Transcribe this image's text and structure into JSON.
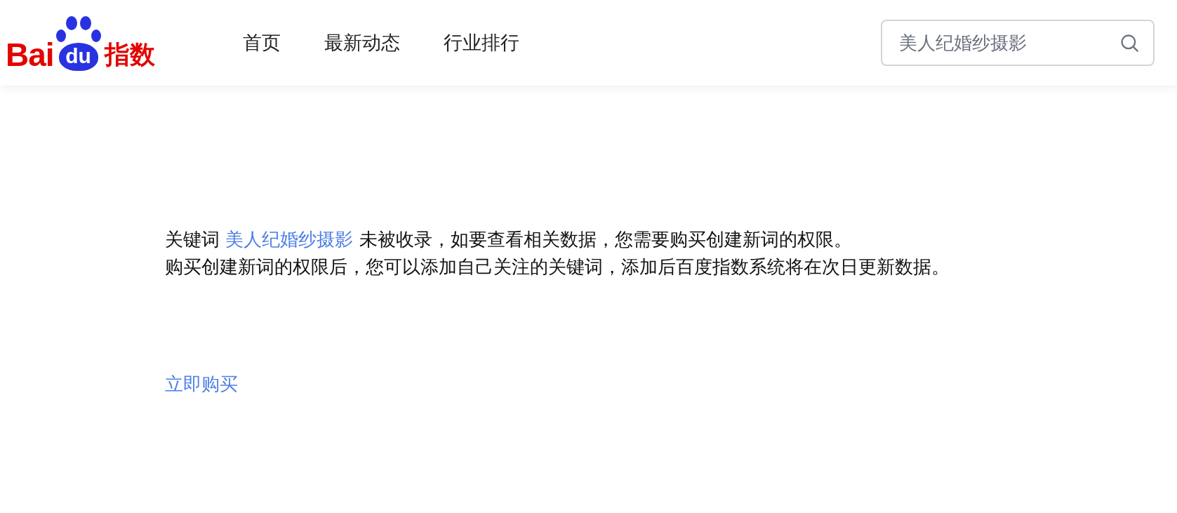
{
  "logo": {
    "latin": "Bai",
    "paw": "du",
    "cjk": "指数"
  },
  "nav": [
    {
      "label": "首页"
    },
    {
      "label": "最新动态"
    },
    {
      "label": "行业排行"
    }
  ],
  "search": {
    "value": "美人纪婚纱摄影"
  },
  "message": {
    "prefix": "关键词",
    "keyword": "美人纪婚纱摄影",
    "suffix": "未被收录，如要查看相关数据，您需要购买创建新词的权限。",
    "note": "购买创建新词的权限后，您可以添加自己关注的关键词，添加后百度指数系统将在次日更新数据。"
  },
  "buy_link": "立即购买"
}
